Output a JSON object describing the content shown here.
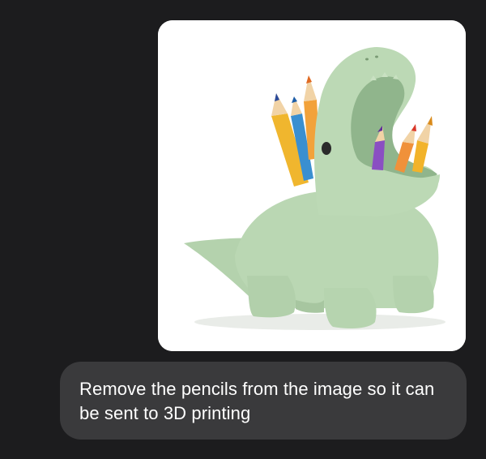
{
  "conversation": {
    "messages": [
      {
        "type": "image",
        "image_label": "dinosaur-pencil-holder-photo"
      },
      {
        "type": "text",
        "text": "Remove the pencils from the image so it can be sent to 3D printing"
      }
    ]
  },
  "colors": {
    "background": "#1c1c1e",
    "bubble": "#3a3a3c",
    "text": "#ffffff",
    "dino": "#b9d6b2"
  }
}
